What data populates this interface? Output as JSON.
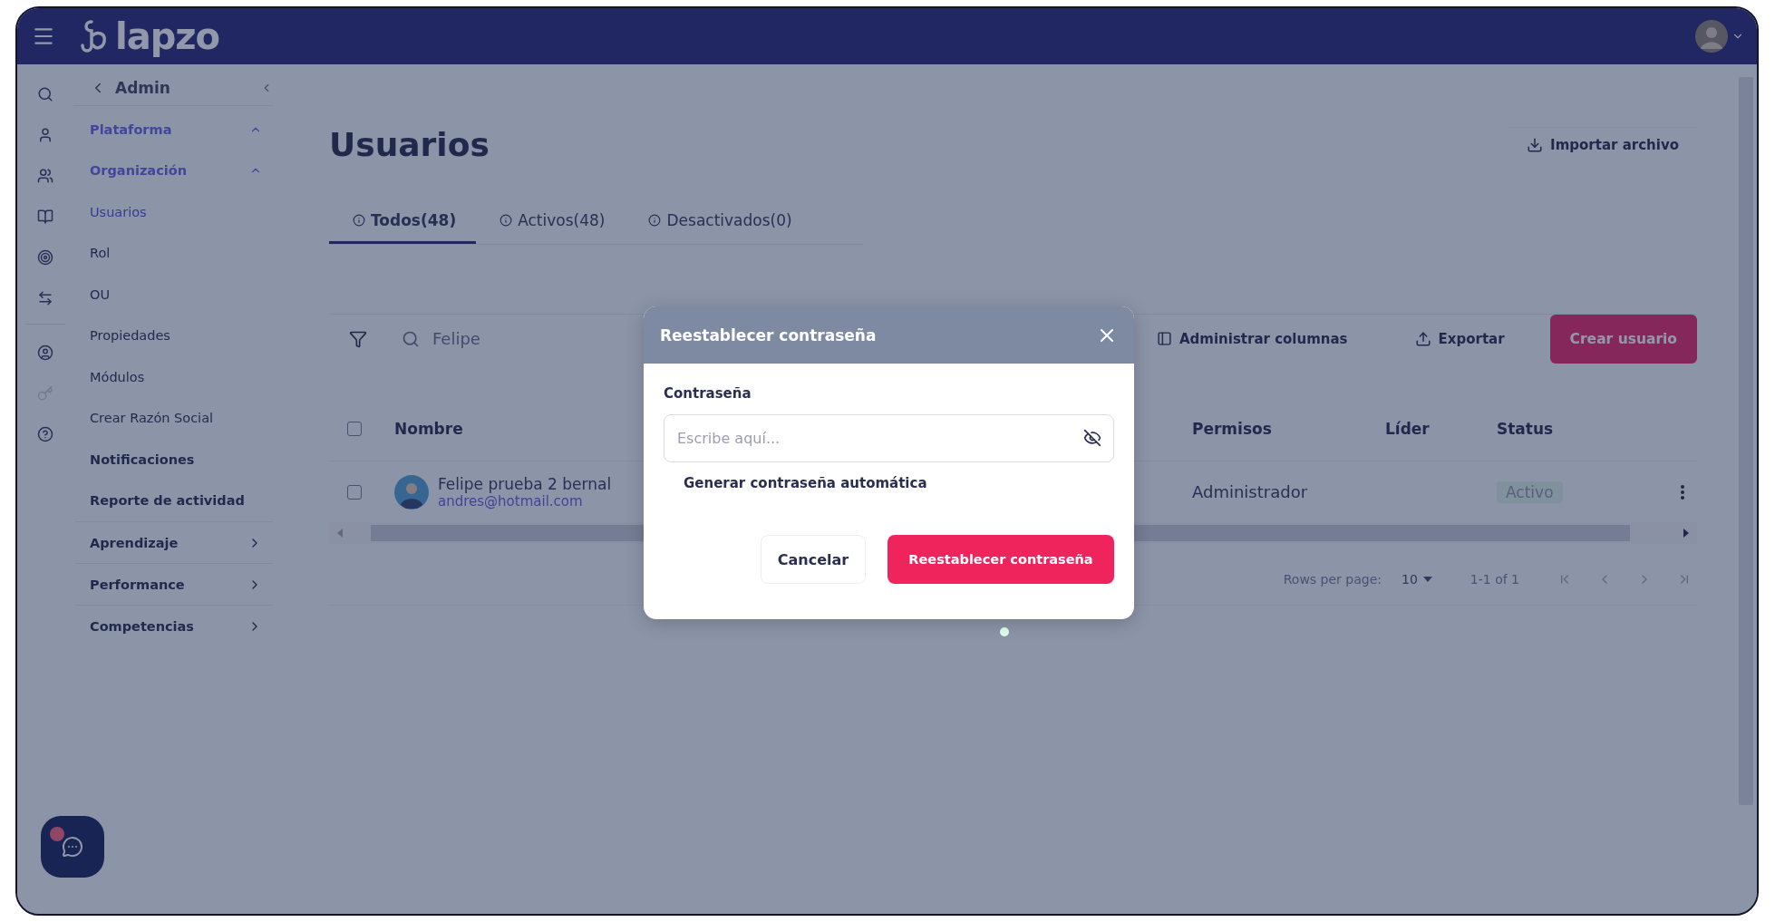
{
  "topbar": {
    "logo": "lapzo"
  },
  "sidebar": {
    "back_label": "Admin",
    "items": [
      {
        "label": "Plataforma",
        "kind": "group",
        "expanded": true,
        "selected": false
      },
      {
        "label": "Organización",
        "kind": "group",
        "expanded": true,
        "selected": false
      },
      {
        "label": "Usuarios",
        "kind": "link",
        "selected": true
      },
      {
        "label": "Rol",
        "kind": "link",
        "selected": false
      },
      {
        "label": "OU",
        "kind": "link",
        "selected": false
      },
      {
        "label": "Propiedades",
        "kind": "link",
        "selected": false
      },
      {
        "label": "Módulos",
        "kind": "link",
        "selected": false
      },
      {
        "label": "Crear Razón Social",
        "kind": "link",
        "selected": false
      },
      {
        "label": "Notificaciones",
        "kind": "section",
        "selected": false
      },
      {
        "label": "Reporte de actividad",
        "kind": "section",
        "selected": false
      },
      {
        "label": "Aprendizaje",
        "kind": "menu",
        "selected": false
      },
      {
        "label": "Performance",
        "kind": "menu",
        "selected": false
      },
      {
        "label": "Competencias",
        "kind": "menu",
        "selected": false
      }
    ]
  },
  "page": {
    "title": "Usuarios",
    "import_button": "Importar archivo"
  },
  "tabs": [
    {
      "label": "Todos(48)",
      "selected": true
    },
    {
      "label": "Activos(48)",
      "selected": false
    },
    {
      "label": "Desactivados(0)",
      "selected": false
    }
  ],
  "toolbar": {
    "search_value": "Felipe",
    "columns_button": "Administrar columnas",
    "export_button": "Exportar",
    "create_button": "Crear usuario"
  },
  "table": {
    "header_checked": false,
    "columns": [
      "Nombre",
      "Permisos",
      "Líder",
      "Status"
    ],
    "rows": [
      {
        "checked": false,
        "name": "Felipe prueba 2 bernal",
        "email": "andres@hotmail.com",
        "permisos": "Administrador",
        "status": "Activo"
      }
    ]
  },
  "pagination": {
    "rows_label": "Rows per page:",
    "rows_value": "10",
    "range": "1-1 of 1"
  },
  "dialog": {
    "title": "Reestablecer contraseña",
    "field_label": "Contraseña",
    "placeholder": "Escribe aquí...",
    "generate_link": "Generar contraseña automática",
    "cancel": "Cancelar",
    "confirm": "Reestablecer contraseña"
  },
  "chat": {
    "unread": true
  }
}
